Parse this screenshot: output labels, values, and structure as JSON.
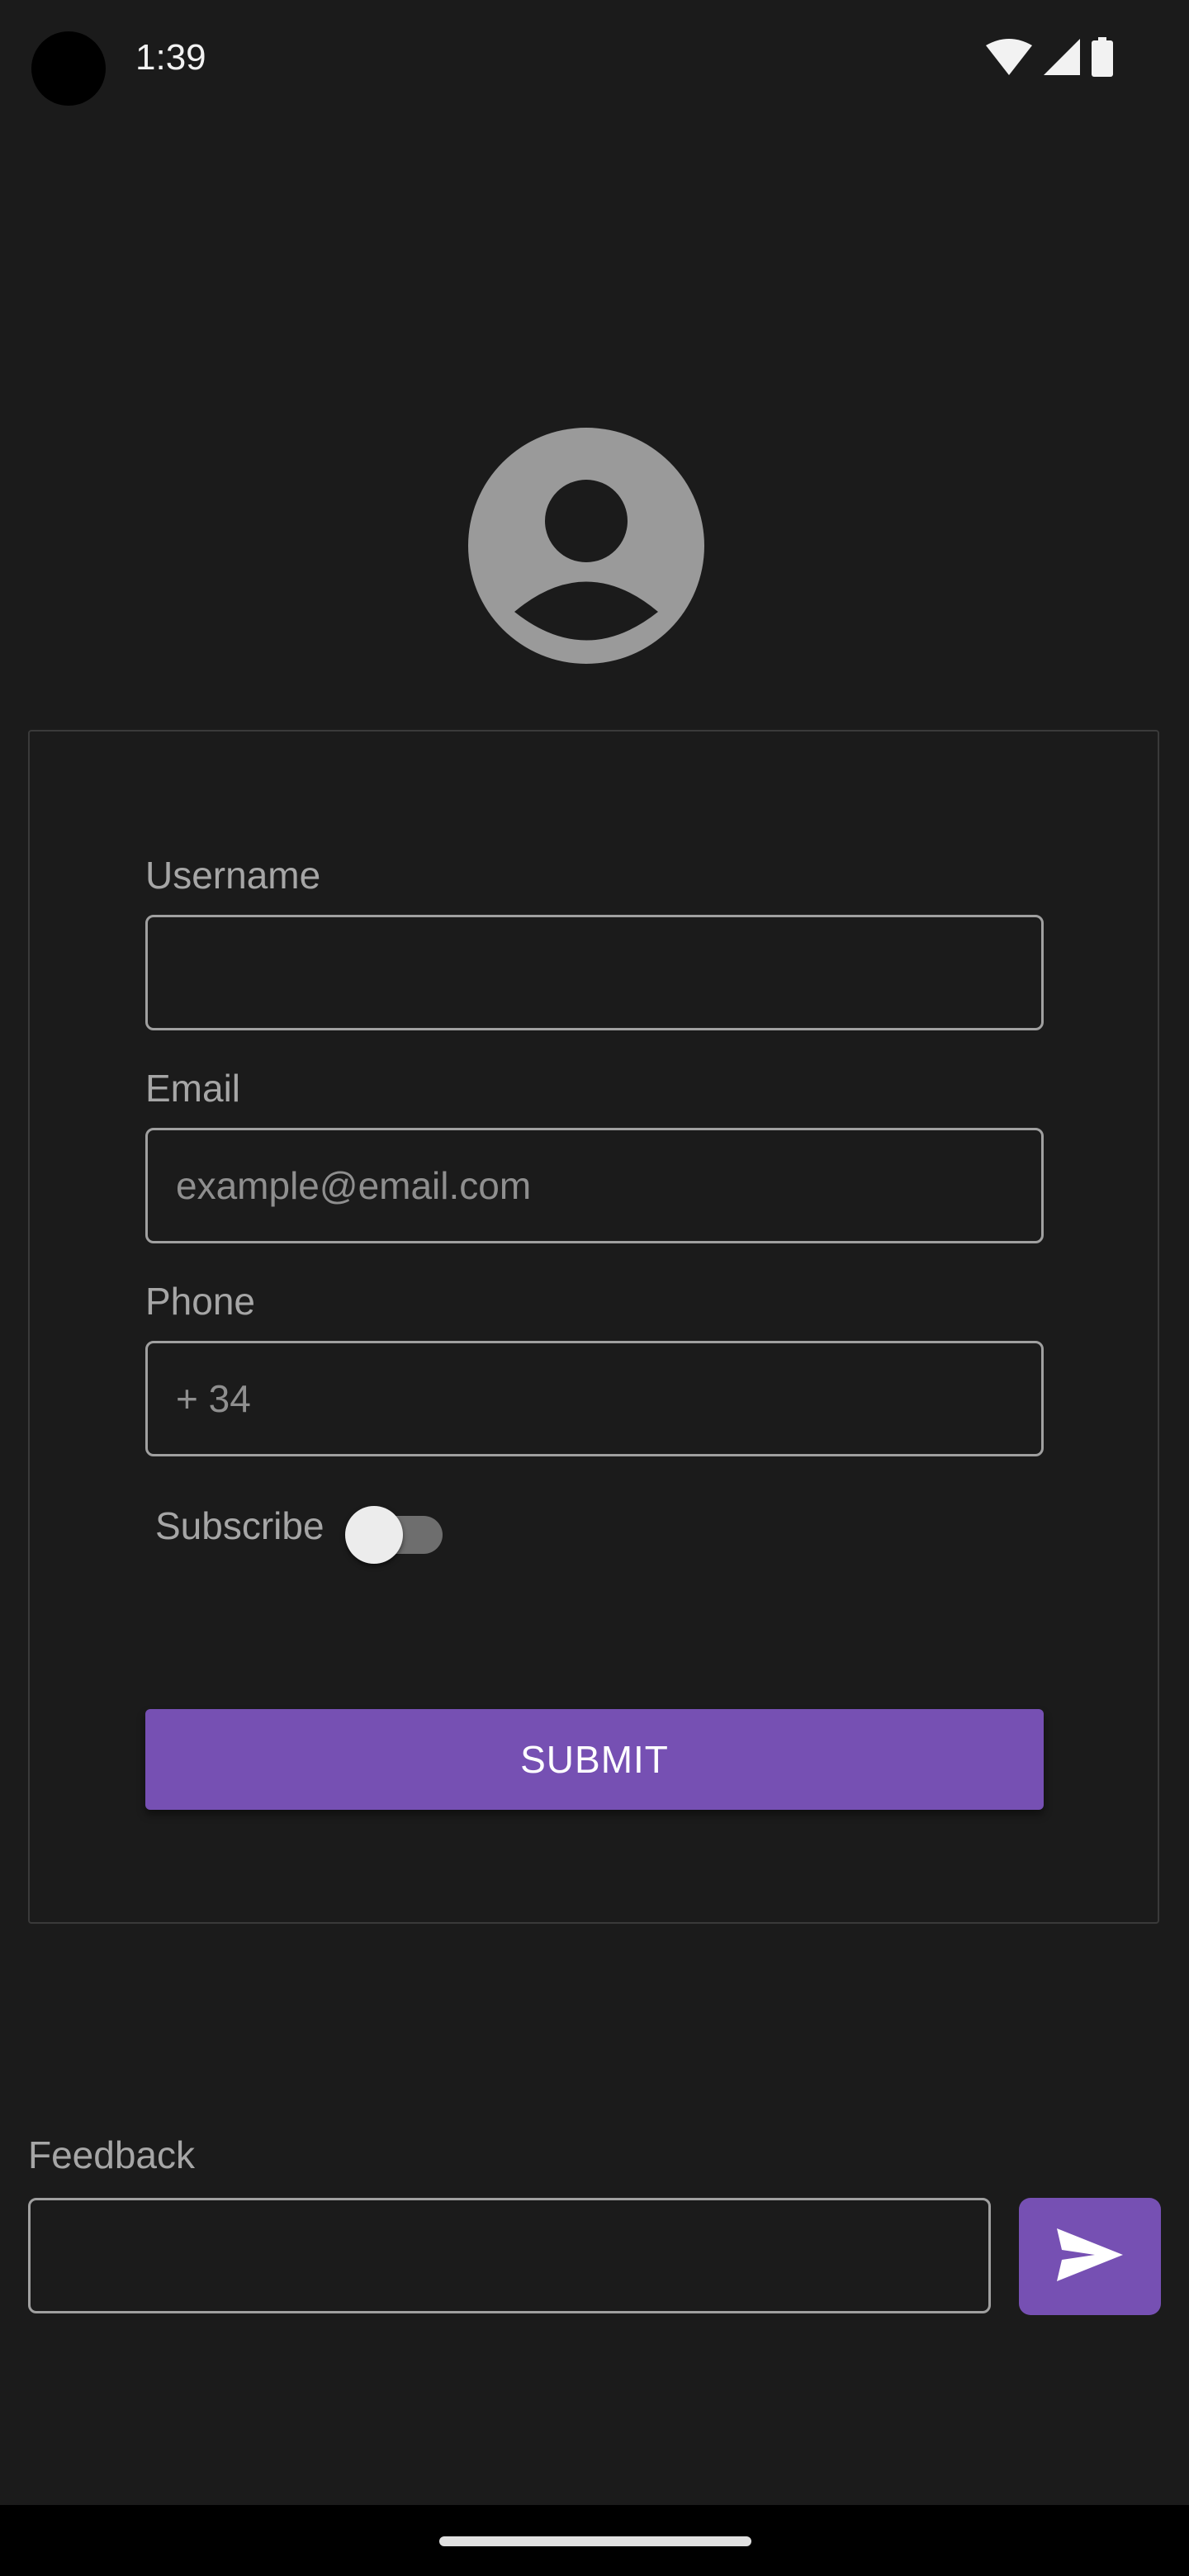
{
  "status_bar": {
    "time": "1:39",
    "icons": [
      "wifi-icon",
      "signal-icon",
      "battery-icon"
    ]
  },
  "avatar": {
    "icon": "account-circle-icon",
    "color": "#9a9a9a"
  },
  "form": {
    "username": {
      "label": "Username",
      "value": "",
      "placeholder": ""
    },
    "email": {
      "label": "Email",
      "value": "",
      "placeholder": "example@email.com"
    },
    "phone": {
      "label": "Phone",
      "value": "+ 34"
    },
    "subscribe": {
      "label": "Subscribe",
      "checked": false
    },
    "submit_label": "SUBMIT"
  },
  "feedback": {
    "label": "Feedback",
    "value": "",
    "send_icon": "send-icon"
  },
  "colors": {
    "background": "#1b1b1b",
    "accent": "#7650b3",
    "field_border": "#a0a0a0",
    "label_text": "#a6a6a6"
  }
}
